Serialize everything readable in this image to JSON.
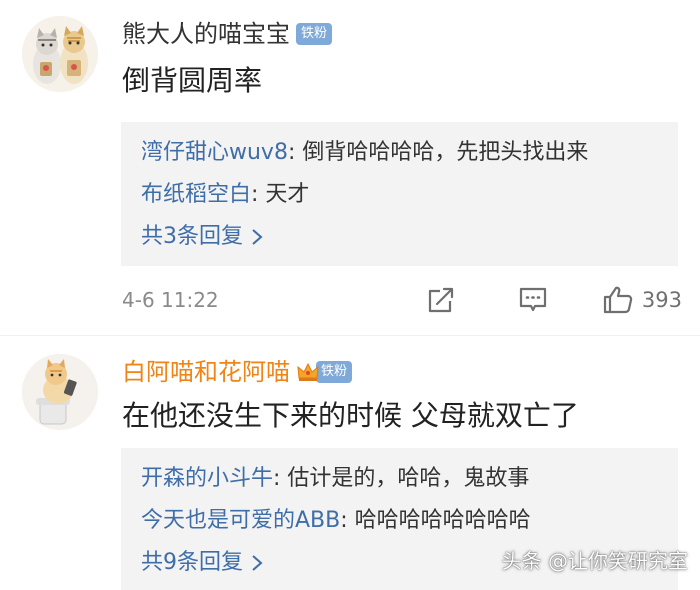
{
  "comments": [
    {
      "username": "熊大人的喵宝宝",
      "badge": "铁粉",
      "content": "倒背圆周率",
      "replies": [
        {
          "name": "湾仔甜心wuv8",
          "text": "倒背哈哈哈哈，先把头找出来"
        },
        {
          "name": "布纸稻空白",
          "text": "天才"
        }
      ],
      "more_replies": "共3条回复",
      "time": "4-6 11:22",
      "likes": "393"
    },
    {
      "username": "白阿喵和花阿喵",
      "badge": "铁粉",
      "content": "在他还没生下来的时候 父母就双亡了",
      "replies": [
        {
          "name": "开森的小斗牛",
          "text": "估计是的，哈哈，鬼故事"
        },
        {
          "name": "今天也是可爱的ABB",
          "text": "哈哈哈哈哈哈哈哈"
        }
      ],
      "more_replies": "共9条回复"
    }
  ],
  "watermark": "头条 @让你笑研究室",
  "colors": {
    "reply_name": "#3f6da8",
    "vip_username": "#f08416",
    "badge": "#7fa9d8",
    "reply_bg": "#f3f3f3"
  }
}
